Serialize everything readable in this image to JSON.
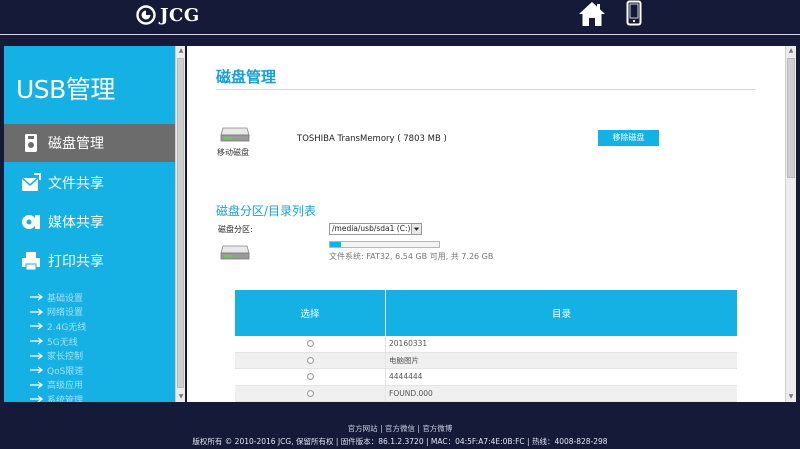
{
  "header": {
    "logo_text": "JCG",
    "home_icon": "home-icon",
    "mobile_icon": "mobile-phone-icon"
  },
  "sidebar": {
    "title": "USB管理",
    "menu": [
      {
        "label": "磁盘管理",
        "icon": "usb-drive-icon",
        "active": true
      },
      {
        "label": "文件共享",
        "icon": "file-share-icon",
        "active": false
      },
      {
        "label": "媒体共享",
        "icon": "media-share-icon",
        "active": false
      },
      {
        "label": "打印共享",
        "icon": "printer-icon",
        "active": false
      }
    ],
    "sub_items": [
      "基础设置",
      "网络设置",
      "2.4G无线",
      "5G无线",
      "家长控制",
      "QoS限速",
      "高级应用",
      "系统管理"
    ]
  },
  "main": {
    "title": "磁盘管理",
    "device": {
      "caption": "移动磁盘",
      "name": "TOSHIBA TransMemory ( 7803 MB )",
      "remove_label": "移除磁盘"
    },
    "partition": {
      "section_title": "磁盘分区/目录列表",
      "label": "磁盘分区:",
      "selected": "/media/usb/sda1 (C:)",
      "usage_fraction": 0.1,
      "fs_info": "文件系统: FAT32, 6.54 GB 可用, 共 7.26 GB"
    },
    "table": {
      "col_select": "选择",
      "col_dir": "目录",
      "rows": [
        "20160331",
        "电脑图片",
        "4444444",
        "FOUND.000"
      ]
    }
  },
  "footer": {
    "link1": "官方网站",
    "link2": "官方微信",
    "link3": "官方微博",
    "separator": "|",
    "copyright": "版权所有 © 2010-2016 JCG, 保留所有权 | 固件版本：86.1.2.3720 | MAC：04:5F:A7:4E:0B:FC | 热线：4008-828-298"
  },
  "colors": {
    "accent": "#15b1e4",
    "background": "#141a38",
    "active_menu": "#6c6c6c"
  }
}
